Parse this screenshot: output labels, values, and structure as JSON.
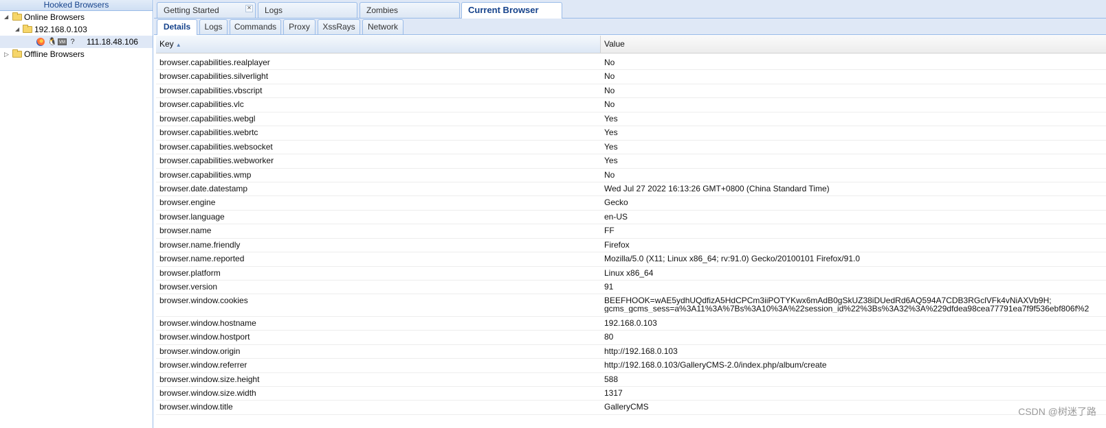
{
  "left_panel": {
    "title": "Hooked Browsers",
    "online": "Online Browsers",
    "host": "192.168.0.103",
    "browser_ip": "111.18.48.106",
    "offline": "Offline Browsers",
    "icons": [
      "firefox-icon",
      "linux-icon",
      "vm-icon",
      "unknown-icon"
    ]
  },
  "main_tabs": [
    {
      "label": "Getting Started",
      "closable": true
    },
    {
      "label": "Logs"
    },
    {
      "label": "Zombies"
    },
    {
      "label": "Current Browser",
      "active": true
    }
  ],
  "sub_tabs": [
    {
      "label": "Details",
      "active": true
    },
    {
      "label": "Logs"
    },
    {
      "label": "Commands"
    },
    {
      "label": "Proxy"
    },
    {
      "label": "XssRays"
    },
    {
      "label": "Network"
    }
  ],
  "grid": {
    "key_header": "Key",
    "value_header": "Value",
    "rows": [
      {
        "k": "browser.capabilities.realplayer",
        "v": "No"
      },
      {
        "k": "browser.capabilities.silverlight",
        "v": "No"
      },
      {
        "k": "browser.capabilities.vbscript",
        "v": "No"
      },
      {
        "k": "browser.capabilities.vlc",
        "v": "No"
      },
      {
        "k": "browser.capabilities.webgl",
        "v": "Yes"
      },
      {
        "k": "browser.capabilities.webrtc",
        "v": "Yes"
      },
      {
        "k": "browser.capabilities.websocket",
        "v": "Yes"
      },
      {
        "k": "browser.capabilities.webworker",
        "v": "Yes"
      },
      {
        "k": "browser.capabilities.wmp",
        "v": "No"
      },
      {
        "k": "browser.date.datestamp",
        "v": "Wed Jul 27 2022 16:13:26 GMT+0800 (China Standard Time)"
      },
      {
        "k": "browser.engine",
        "v": "Gecko"
      },
      {
        "k": "browser.language",
        "v": "en-US"
      },
      {
        "k": "browser.name",
        "v": "FF"
      },
      {
        "k": "browser.name.friendly",
        "v": "Firefox"
      },
      {
        "k": "browser.name.reported",
        "v": "Mozilla/5.0 (X11; Linux x86_64; rv:91.0) Gecko/20100101 Firefox/91.0"
      },
      {
        "k": "browser.platform",
        "v": "Linux x86_64"
      },
      {
        "k": "browser.version",
        "v": "91"
      },
      {
        "k": "browser.window.cookies",
        "v": "BEEFHOOK=wAE5ydhUQdfizA5HdCPCm3iiPOTYKwx6mAdB0gSkUZ38iDUedRd6AQ594A7CDB3RGclVFk4vNiAXVb9H;",
        "v2": "gcms_gcms_sess=a%3A11%3A%7Bs%3A10%3A%22session_id%22%3Bs%3A32%3A%229dfdea98cea77791ea7f9f536ebf806f%2"
      },
      {
        "k": "browser.window.hostname",
        "v": "192.168.0.103"
      },
      {
        "k": "browser.window.hostport",
        "v": "80"
      },
      {
        "k": "browser.window.origin",
        "v": "http://192.168.0.103"
      },
      {
        "k": "browser.window.referrer",
        "v": "http://192.168.0.103/GalleryCMS-2.0/index.php/album/create"
      },
      {
        "k": "browser.window.size.height",
        "v": "588"
      },
      {
        "k": "browser.window.size.width",
        "v": "1317"
      },
      {
        "k": "browser.window.title",
        "v": "GalleryCMS"
      }
    ]
  },
  "watermark": "CSDN @树迷了路"
}
